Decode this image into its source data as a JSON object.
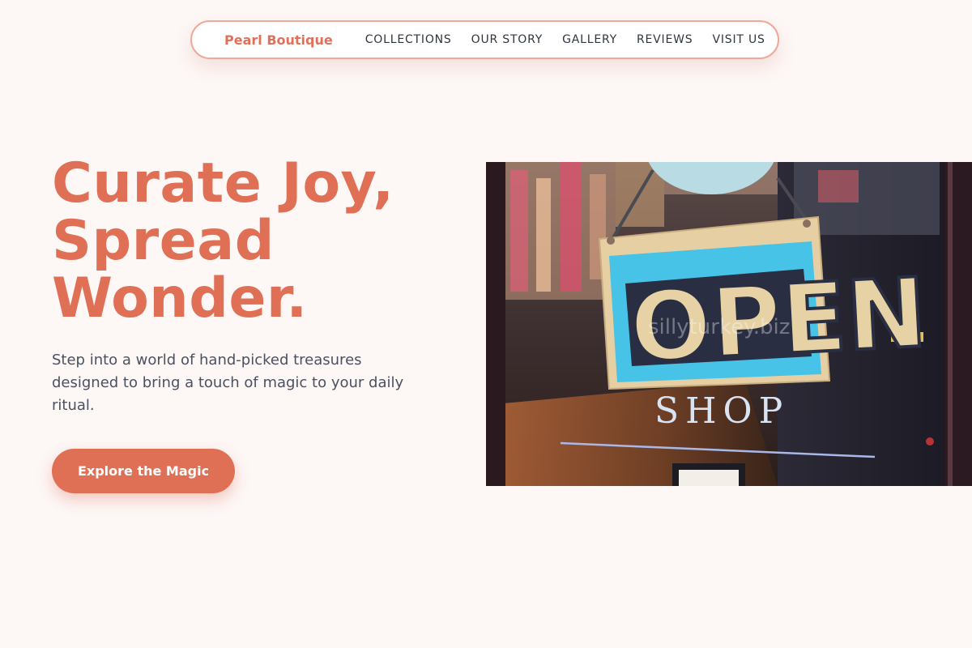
{
  "nav": {
    "brand": "Pearl Boutique",
    "links": [
      "COLLECTIONS",
      "OUR STORY",
      "GALLERY",
      "REVIEWS",
      "VISIT US"
    ]
  },
  "hero": {
    "title_lines": [
      "Curate Joy,",
      "Spread",
      "Wonder."
    ],
    "subtitle": "Step into a world of hand-picked treasures designed to bring a touch of magic to your daily ritual.",
    "cta_label": "Explore the Magic"
  },
  "photo": {
    "sign_text": "OPEN",
    "shop_text": "SHOP",
    "watermark": "sillyturkey.biz"
  },
  "colors": {
    "accent": "#e07055",
    "background": "#fdf7f6",
    "nav_border": "#f0a898",
    "body_text": "#4b5160"
  }
}
